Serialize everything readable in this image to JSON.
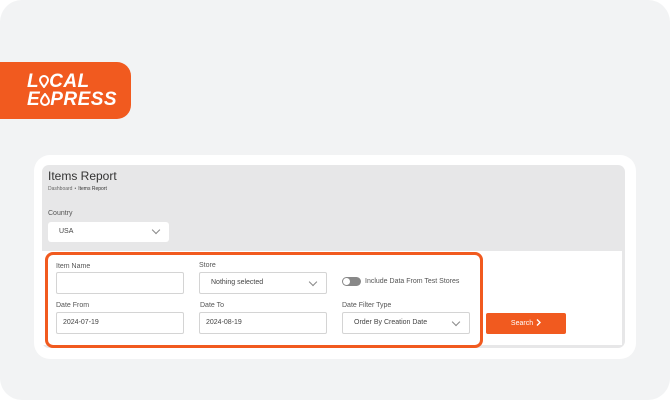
{
  "logo": {
    "line1_a": "L",
    "line1_b": "CAL",
    "line2_a": "E",
    "line2_b": "PRESS"
  },
  "page": {
    "title": "Items Report",
    "breadcrumb": {
      "home": "Dashboard",
      "separator": "•",
      "current": "Items Report"
    }
  },
  "filters": {
    "country_label": "Country",
    "country_value": "USA",
    "item_name_label": "Item Name",
    "item_name_value": "",
    "store_label": "Store",
    "store_value": "Nothing selected",
    "include_test_label": "Include Data From Test Stores",
    "date_from_label": "Date From",
    "date_from_value": "2024-07-19",
    "date_to_label": "Date To",
    "date_to_value": "2024-08-19",
    "date_filter_type_label": "Date Filter Type",
    "date_filter_type_value": "Order By Creation Date"
  },
  "actions": {
    "search_label": "Search",
    "search_icon": "chevron-right-icon"
  },
  "colors": {
    "brand": "#f15a1f"
  }
}
